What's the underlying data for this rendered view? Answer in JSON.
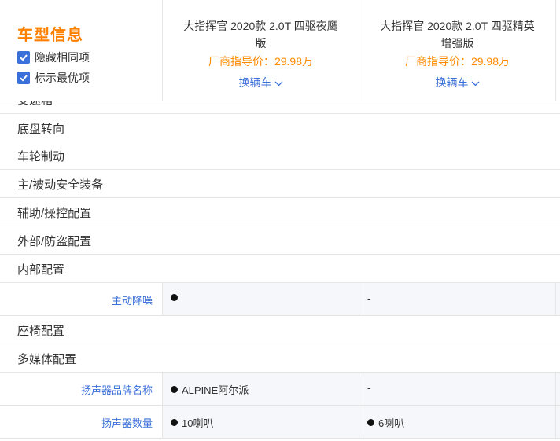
{
  "header": {
    "title": "车型信息",
    "hide_same_label": "隐藏相同项",
    "mark_best_label": "标示最优项",
    "cars": [
      {
        "name": "大指挥官 2020款 2.0T 四驱夜鹰版",
        "price": "厂商指导价：29.98万",
        "switch_label": "换辆车"
      },
      {
        "name": "大指挥官 2020款 2.0T 四驱精英增强版",
        "price": "厂商指导价：29.98万",
        "switch_label": "换辆车"
      }
    ]
  },
  "partial_section": "变速箱",
  "sections": {
    "chassis": "底盘转向",
    "wheels": "车轮制动",
    "safety": "主/被动安全装备",
    "assist": "辅助/操控配置",
    "exterior": "外部/防盗配置",
    "interior": "内部配置",
    "seats": "座椅配置",
    "multimedia": "多媒体配置"
  },
  "rows": {
    "anc": {
      "label": "主动降噪",
      "v1": "",
      "v2": "-"
    },
    "speaker_brand": {
      "label": "扬声器品牌名称",
      "v1": "ALPINE阿尔派",
      "v2": "-"
    },
    "speaker_count": {
      "label": "扬声器数量",
      "v1": "10喇叭",
      "v2": "6喇叭"
    }
  },
  "colors": {
    "accent": "#ff7f00",
    "link": "#3b6fd9",
    "row_bg": "#f5f7fb"
  }
}
